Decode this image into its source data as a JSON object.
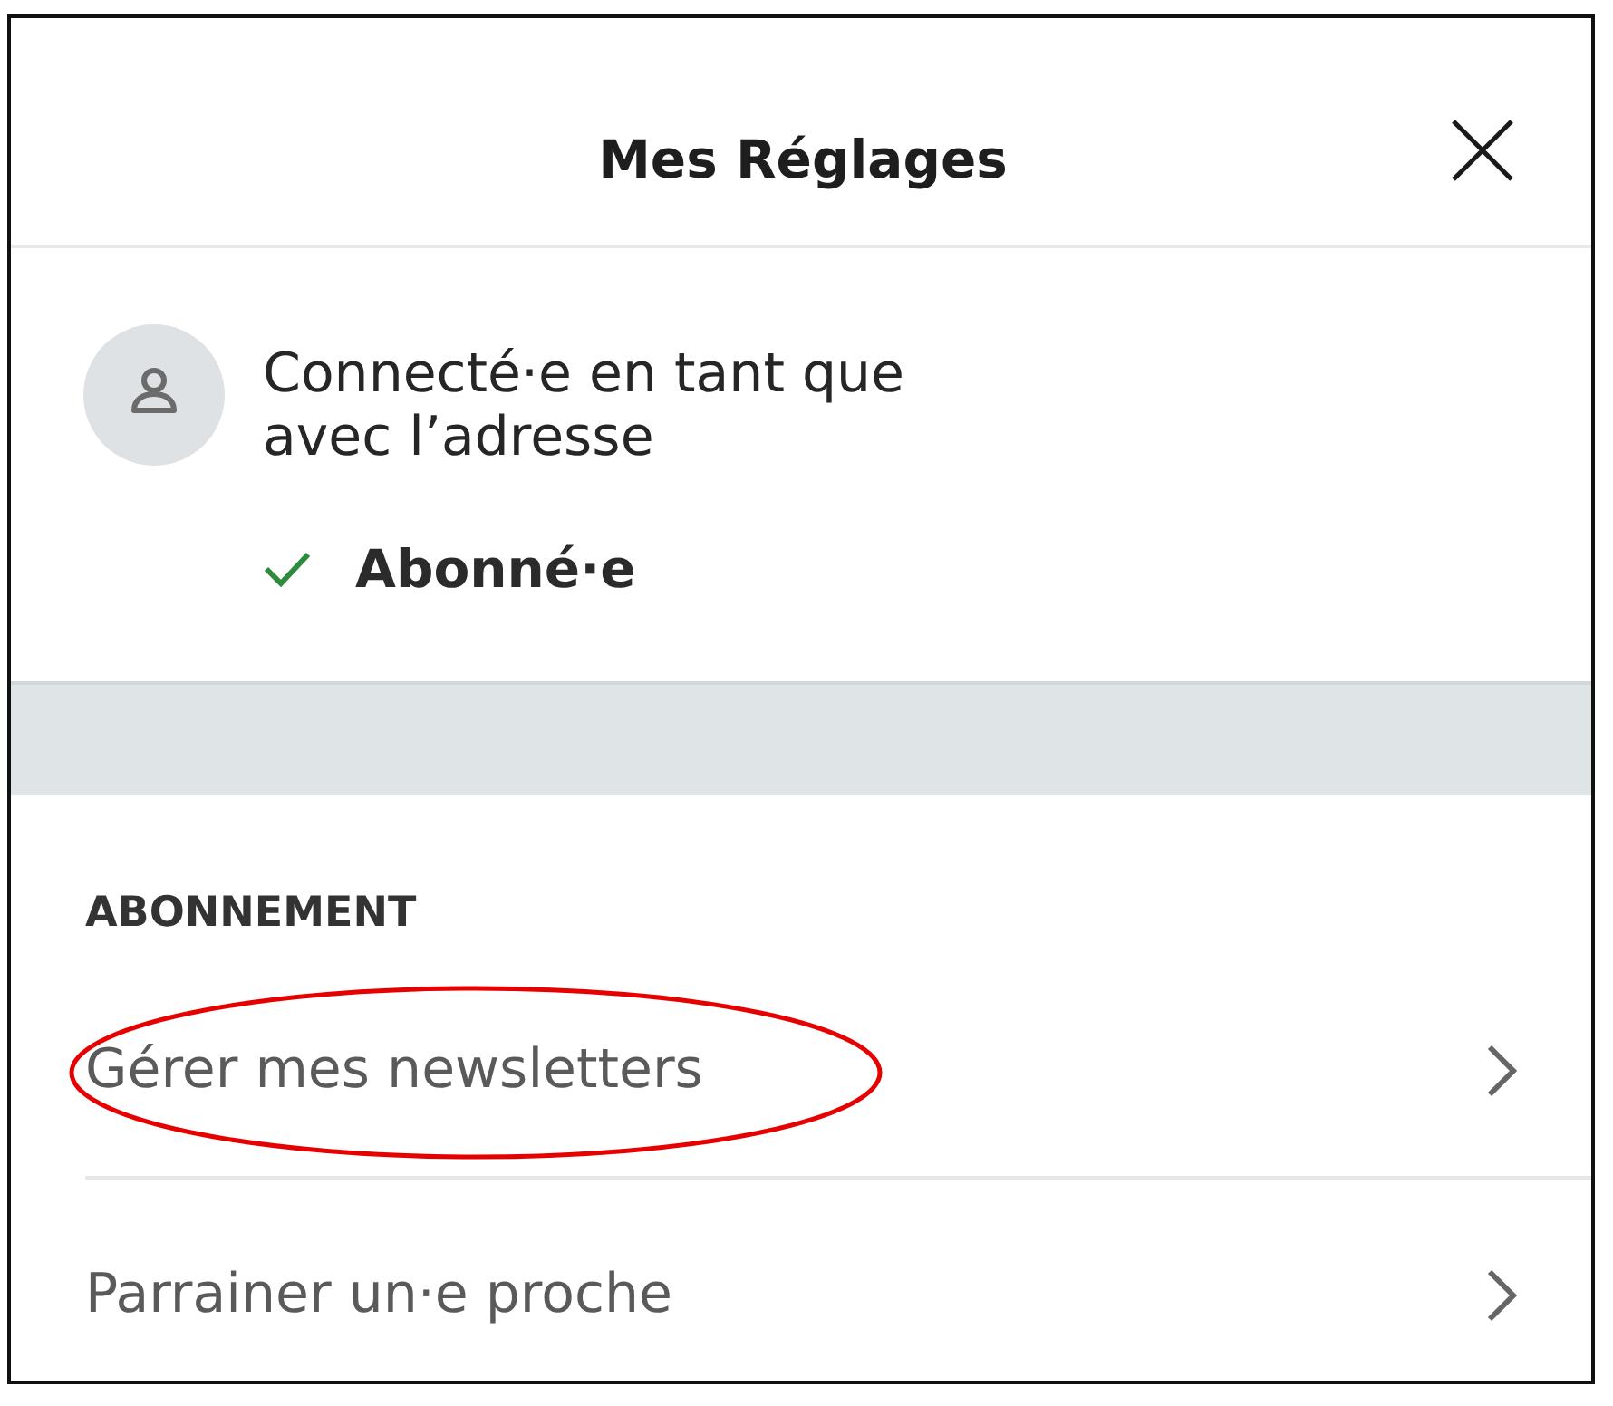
{
  "header": {
    "title": "Mes Réglages"
  },
  "profile": {
    "lines": [
      "Connecté·e en tant que",
      "avec l’adresse"
    ]
  },
  "subscription": {
    "label": "Abonné·e",
    "subscribed": true
  },
  "sections": [
    {
      "heading": "ABONNEMENT",
      "items": [
        {
          "label": "Gérer mes newsletters",
          "circled": true
        },
        {
          "label": "Parrainer un·e proche",
          "circled": false
        }
      ]
    }
  ]
}
